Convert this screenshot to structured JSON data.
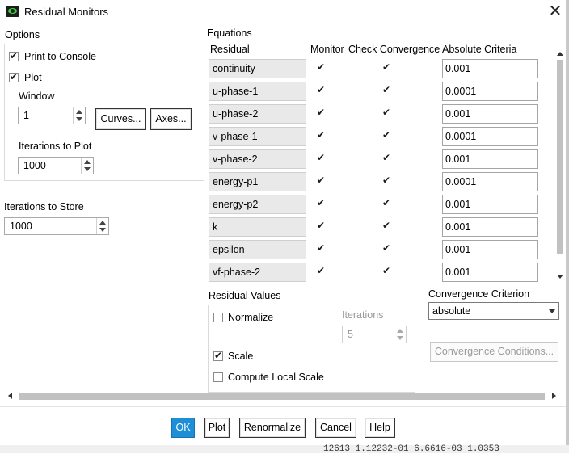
{
  "window": {
    "title": "Residual Monitors",
    "close_glyph": "✕"
  },
  "options": {
    "heading": "Options",
    "print_to_console": {
      "label": "Print to Console",
      "checked": true
    },
    "plot": {
      "label": "Plot",
      "checked": true
    },
    "window_label": "Window",
    "window_value": "1",
    "curves_button": "Curves...",
    "axes_button": "Axes...",
    "iterations_to_plot_label": "Iterations to Plot",
    "iterations_to_plot_value": "1000"
  },
  "store": {
    "label": "Iterations to Store",
    "value": "1000"
  },
  "equations": {
    "heading": "Equations",
    "columns": {
      "residual": "Residual",
      "monitor": "Monitor",
      "check": "Check Convergence",
      "criteria": "Absolute Criteria"
    },
    "rows": [
      {
        "name": "continuity",
        "monitor": true,
        "check": true,
        "criteria": "0.001"
      },
      {
        "name": "u-phase-1",
        "monitor": true,
        "check": true,
        "criteria": "0.0001"
      },
      {
        "name": "u-phase-2",
        "monitor": true,
        "check": true,
        "criteria": "0.001"
      },
      {
        "name": "v-phase-1",
        "monitor": true,
        "check": true,
        "criteria": "0.0001"
      },
      {
        "name": "v-phase-2",
        "monitor": true,
        "check": true,
        "criteria": "0.001"
      },
      {
        "name": "energy-p1",
        "monitor": true,
        "check": true,
        "criteria": "0.0001"
      },
      {
        "name": "energy-p2",
        "monitor": true,
        "check": true,
        "criteria": "0.001"
      },
      {
        "name": "k",
        "monitor": true,
        "check": true,
        "criteria": "0.001"
      },
      {
        "name": "epsilon",
        "monitor": true,
        "check": true,
        "criteria": "0.001"
      },
      {
        "name": "vf-phase-2",
        "monitor": true,
        "check": true,
        "criteria": "0.001"
      }
    ]
  },
  "residual_values": {
    "heading": "Residual Values",
    "normalize": {
      "label": "Normalize",
      "checked": false
    },
    "iterations_label": "Iterations",
    "iterations_value": "5",
    "scale": {
      "label": "Scale",
      "checked": true
    },
    "compute_local_scale": {
      "label": "Compute Local Scale",
      "checked": false
    }
  },
  "convergence": {
    "criterion_label": "Convergence Criterion",
    "criterion_value": "absolute",
    "conditions_button": "Convergence Conditions..."
  },
  "footer": {
    "ok": "OK",
    "plot": "Plot",
    "renormalize": "Renormalize",
    "cancel": "Cancel",
    "help": "Help"
  },
  "background_console_text": "12613  1.12232-01  6.6616-03  1.0353"
}
